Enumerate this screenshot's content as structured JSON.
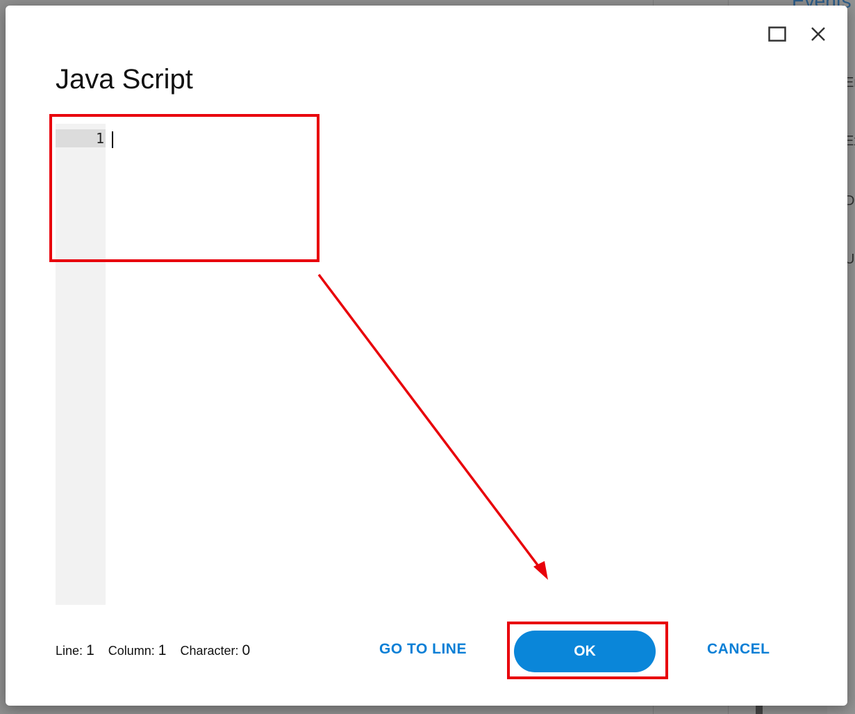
{
  "background": {
    "tab_label": "Events",
    "side_letters": [
      "Er",
      "Ex",
      "Dc",
      "Up"
    ]
  },
  "dialog": {
    "title": "Java Script",
    "window_controls": {
      "maximize_icon": "maximize-icon",
      "close_icon": "close-icon"
    },
    "editor": {
      "line_numbers": [
        "1"
      ],
      "content": ""
    },
    "status": {
      "line_label": "Line:",
      "line_value": "1",
      "column_label": "Column:",
      "column_value": "1",
      "character_label": "Character:",
      "character_value": "0"
    },
    "buttons": {
      "goto_line": "GO TO LINE",
      "ok": "OK",
      "cancel": "CANCEL"
    }
  },
  "colors": {
    "accent": "#0a86d9",
    "annotation": "#e8000a"
  }
}
